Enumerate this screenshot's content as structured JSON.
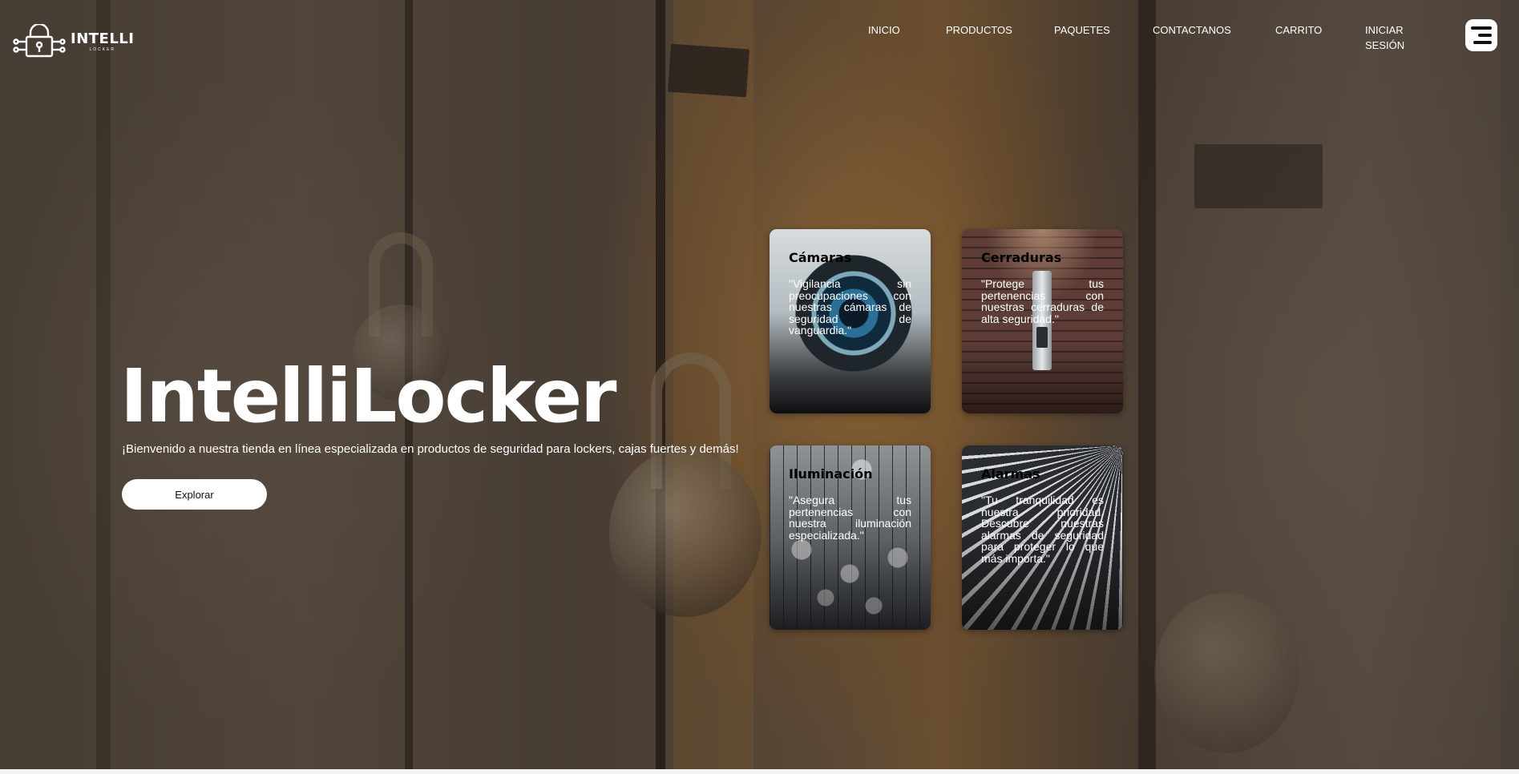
{
  "header": {
    "logo": {
      "brand": "INTELLI",
      "tagline": "LOCKER"
    },
    "nav": [
      {
        "label": "INICIO"
      },
      {
        "label": "PRODUCTOS"
      },
      {
        "label": "PAQUETES"
      },
      {
        "label": "CONTACTANOS"
      },
      {
        "label": "CARRITO"
      },
      {
        "label": "INICIAR\nSESIÓN"
      }
    ],
    "menu_icon": "hamburger-menu-icon"
  },
  "hero": {
    "title": "IntelliLocker",
    "subtitle": "¡Bienvenido a nuestra tienda en línea especializada en productos de seguridad para lockers, cajas fuertes y demás!",
    "cta_label": "Explorar"
  },
  "cards": [
    {
      "title": "Cámaras",
      "description": "\"Vigilancia sin preocupaciones con nuestras cámaras de seguridad de vanguardia.\""
    },
    {
      "title": "Cerraduras",
      "description": "\"Protege tus pertenencias con nuestras cerraduras de alta seguridad.\""
    },
    {
      "title": "Iluminación",
      "description": "\"Asegura tus pertenencias con nuestra iluminación especializada.\""
    },
    {
      "title": "Alarmas",
      "description": "\"Tu tranquilidad es nuestra prioridad. Descubre nuestras alarmas de seguridad para proteger lo que más importa.\""
    }
  ],
  "colors": {
    "text": "#ffffff",
    "button_bg": "#ffffff",
    "button_text": "#111111",
    "card_title": "#000000"
  }
}
